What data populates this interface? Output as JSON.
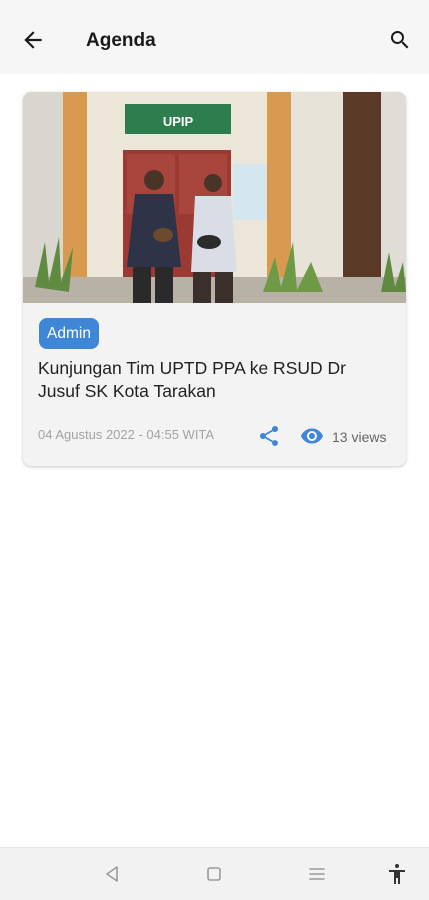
{
  "header": {
    "title": "Agenda",
    "back_icon": "arrow-left-icon",
    "search_icon": "search-icon"
  },
  "post": {
    "image_alt": "Two men standing in front of the UPIP office door",
    "sign_text": "UPIP",
    "author_badge": "Admin",
    "title": "Kunjungan Tim UPTD PPA ke RSUD Dr Jusuf SK Kota Tarakan",
    "date": "04 Agustus 2022 - 04:55 WITA",
    "views": "13 views",
    "share_icon": "share-icon",
    "views_icon": "eye-icon"
  },
  "system_nav": {
    "back_icon": "triangle-back-icon",
    "home_icon": "square-home-icon",
    "recents_icon": "menu-lines-icon",
    "accessibility_icon": "accessibility-icon"
  },
  "colors": {
    "accent": "#3f87d6",
    "appbar_bg": "#f6f6f6",
    "card_bg": "#f3f3f3"
  }
}
